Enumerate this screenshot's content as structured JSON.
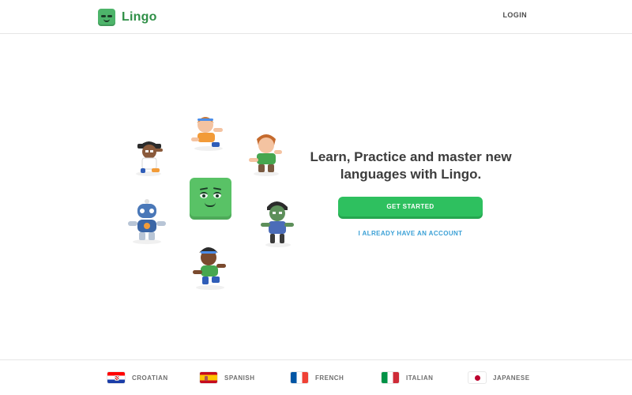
{
  "header": {
    "brand_name": "Lingo",
    "login_label": "LOGIN"
  },
  "hero": {
    "tagline_line1": "Learn, Practice and master new",
    "tagline_line2": "languages with Lingo.",
    "get_started_label": "GET STARTED",
    "have_account_label": "I ALREADY HAVE AN ACCOUNT"
  },
  "illustration": {
    "mascot": "lingo-mascot-icon",
    "characters": [
      "character-boy-with-hat",
      "character-girl-waving",
      "character-boy-green-shirt",
      "character-robot",
      "character-zombie",
      "character-girl-running"
    ]
  },
  "languages": [
    {
      "label": "CROATIAN",
      "flag_icon": "croatia-flag-icon"
    },
    {
      "label": "SPANISH",
      "flag_icon": "spain-flag-icon"
    },
    {
      "label": "FRENCH",
      "flag_icon": "france-flag-icon"
    },
    {
      "label": "ITALIAN",
      "flag_icon": "italy-flag-icon"
    },
    {
      "label": "JAPANESE",
      "flag_icon": "japan-flag-icon"
    }
  ],
  "colors": {
    "brand_green": "#2f8f47",
    "button_green": "#2ec05f",
    "link_blue": "#3aa0d6"
  }
}
